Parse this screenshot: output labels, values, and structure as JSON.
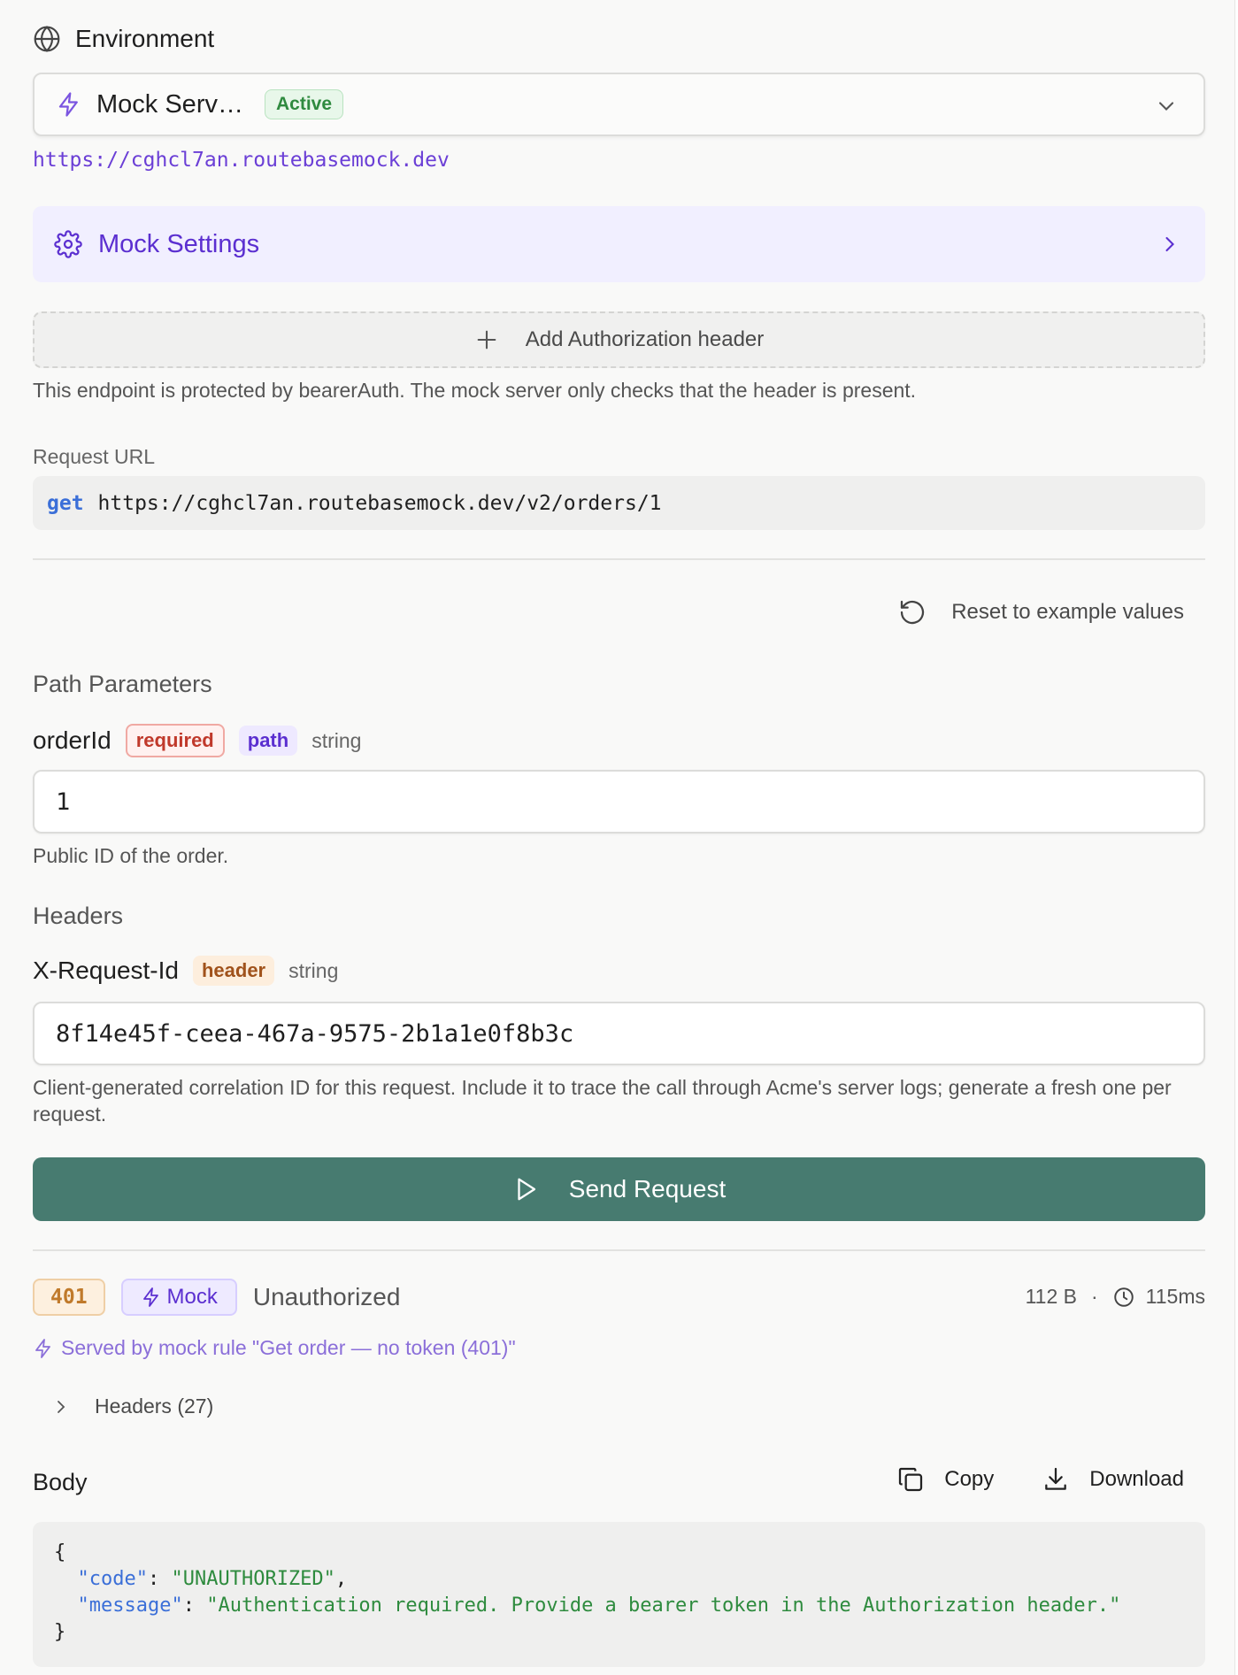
{
  "environment": {
    "heading": "Environment",
    "selected_name": "Mock Serv…",
    "status_badge": "Active",
    "base_url": "https://cghcl7an.routebasemock.dev"
  },
  "mock_settings": {
    "label": "Mock Settings"
  },
  "auth": {
    "add_label": "Add Authorization header",
    "note": "This endpoint is protected by bearerAuth. The mock server only checks that the header is present."
  },
  "request_url": {
    "label": "Request URL",
    "method": "get",
    "url": "https://cghcl7an.routebasemock.dev/v2/orders/1"
  },
  "reset_label": "Reset to example values",
  "path_parameters": {
    "title": "Path Parameters",
    "params": [
      {
        "name": "orderId",
        "required_tag": "required",
        "location_tag": "path",
        "type": "string",
        "value": "1",
        "description": "Public ID of the order."
      }
    ]
  },
  "headers_section": {
    "title": "Headers",
    "params": [
      {
        "name": "X-Request-Id",
        "location_tag": "header",
        "type": "string",
        "value": "8f14e45f-ceea-467a-9575-2b1a1e0f8b3c",
        "description": "Client-generated correlation ID for this request. Include it to trace the call through Acme's server logs; generate a fresh one per request."
      }
    ]
  },
  "send_button": {
    "label": "Send Request"
  },
  "response": {
    "status_code": "401",
    "mock_badge": "Mock",
    "status_text": "Unauthorized",
    "size": "112 B",
    "separator": "·",
    "duration": "115ms",
    "served_by": "Served by mock rule \"Get order — no token (401)\"",
    "headers_toggle": "Headers (27)",
    "body_title": "Body",
    "copy_label": "Copy",
    "download_label": "Download",
    "body": {
      "open": "{",
      "code_key": "\"code\"",
      "code_value": "\"UNAUTHORIZED\"",
      "message_key": "\"message\"",
      "message_value": "\"Authentication required. Provide a bearer token in the Authorization header.\"",
      "close": "}"
    }
  },
  "colors": {
    "accent_purple": "#5b2fd0",
    "send_button": "#477b70",
    "active_green": "#2f8a3f",
    "status_orange": "#c07a2b"
  }
}
